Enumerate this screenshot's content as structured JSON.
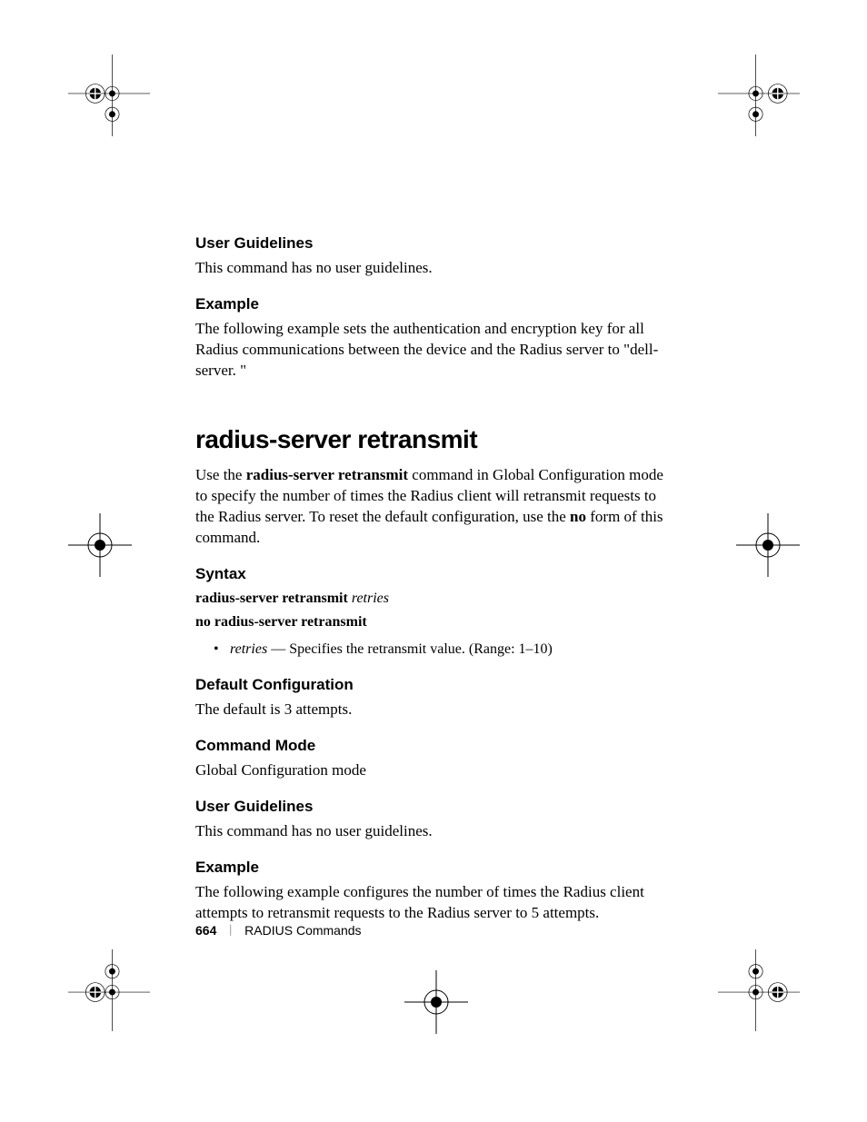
{
  "sections": {
    "ug1_heading": "User Guidelines",
    "ug1_body": "This command has no user guidelines.",
    "ex1_heading": "Example",
    "ex1_body": "The following example sets the authentication and encryption key for all Radius communications between the device and the Radius server to \"dell-server. \"",
    "title": "radius-server retransmit",
    "intro_p1": "Use the ",
    "intro_cmd": "radius-server retransmit",
    "intro_p2": " command in Global Configuration mode to specify the number of times the Radius client will retransmit requests to the Radius server. To reset the default configuration, use the ",
    "intro_no": "no",
    "intro_p3": " form of this command.",
    "syntax_heading": "Syntax",
    "syntax1_bold": "radius-server retransmit ",
    "syntax1_italic": "retries",
    "syntax2": "no radius-server retransmit",
    "bullet_italic": "retries ",
    "bullet_rest": "— Specifies the retransmit value. (Range: 1–10)",
    "defcfg_heading": "Default Configuration",
    "defcfg_body": "The default is 3 attempts.",
    "cmdmode_heading": "Command Mode",
    "cmdmode_body": "Global Configuration mode",
    "ug2_heading": "User Guidelines",
    "ug2_body": "This command has no user guidelines.",
    "ex2_heading": "Example",
    "ex2_body": "The following example configures the number of times the Radius client attempts to retransmit requests to the Radius server to 5 attempts."
  },
  "footer": {
    "page": "664",
    "sep": "|",
    "label": "RADIUS Commands"
  }
}
